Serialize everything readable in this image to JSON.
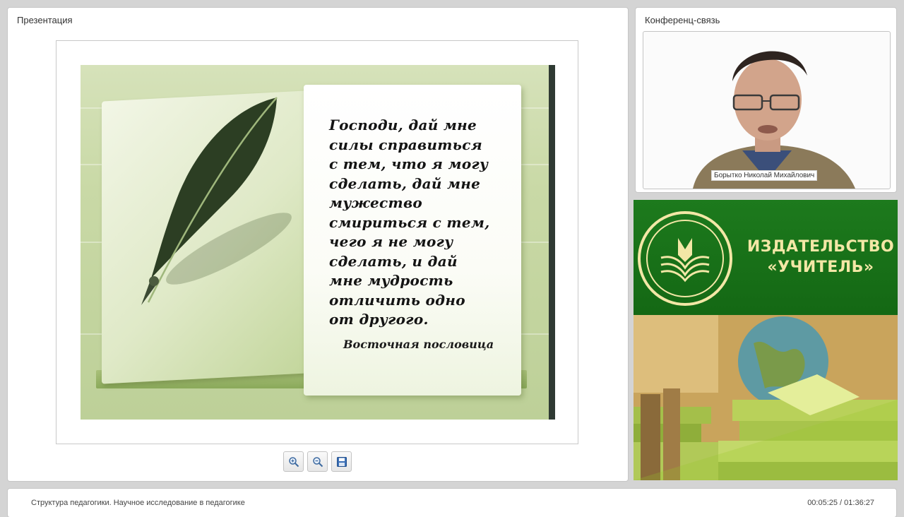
{
  "presentation": {
    "panel_title": "Презентация",
    "slide": {
      "quote": "Господи, дай мне\nсилы справиться\nс тем, что я могу\nсделать, дай мне\nмужество\nсмириться с тем,\nчего я не могу\nсделать, и дай\nмне мудрость\nотличить одно\nот другого.",
      "source": "Восточная пословица"
    },
    "toolbar": [
      {
        "name": "zoom-in",
        "icon": "zoom-in-icon"
      },
      {
        "name": "zoom-out",
        "icon": "zoom-out-icon"
      },
      {
        "name": "save",
        "icon": "save-icon"
      }
    ]
  },
  "conference": {
    "panel_title": "Конференц-связь",
    "speaker_name": "Борытко Николай Михайлович"
  },
  "banner": {
    "publisher_name": "ИЗДАТЕЛЬСТВО\n«УЧИТЕЛЬ»"
  },
  "footer": {
    "lecture_title": "Структура педагогики. Научное исследование в педагогике",
    "timecode": "00:05:25 / 01:36:27"
  },
  "colors": {
    "banner_green": "#146814",
    "banner_text": "#f3e7a6"
  }
}
